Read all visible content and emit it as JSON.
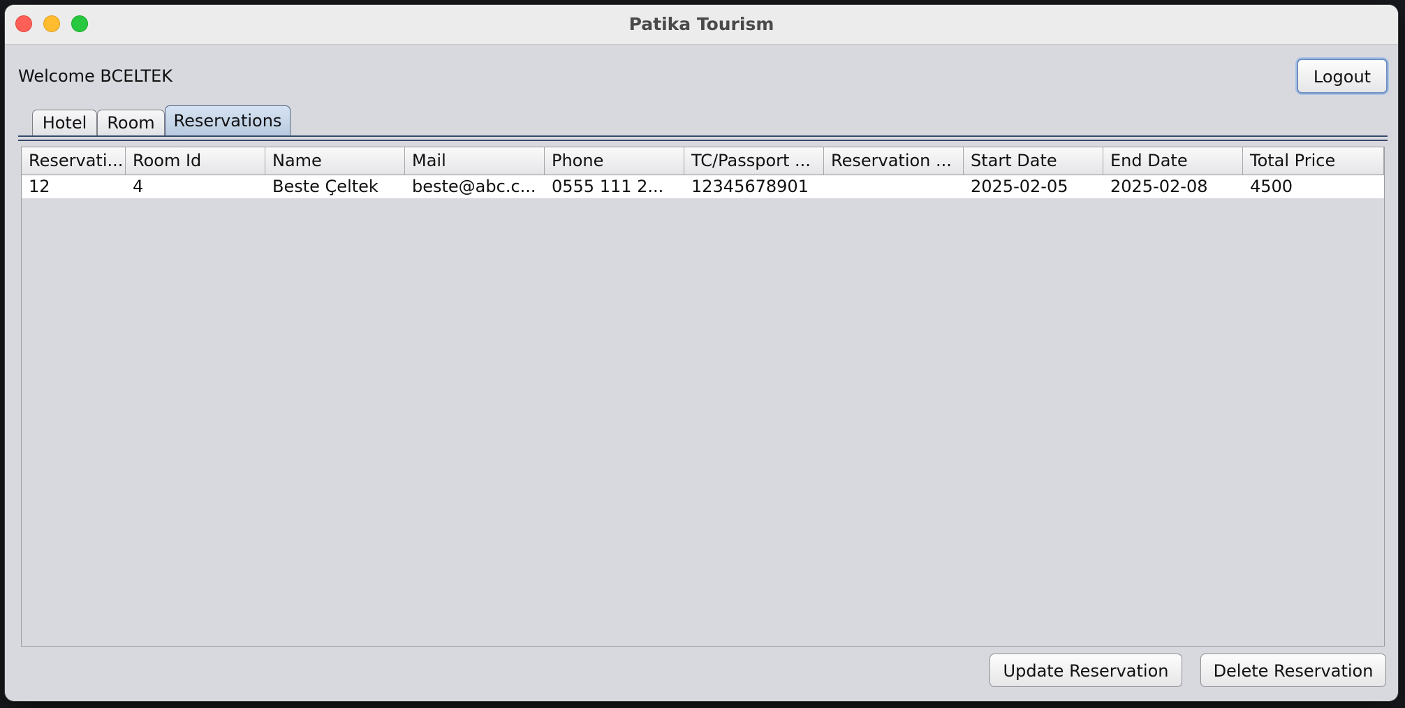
{
  "window": {
    "title": "Patika Tourism"
  },
  "header": {
    "welcome": "Welcome BCELTEK",
    "logout_label": "Logout"
  },
  "tabs": [
    {
      "label": "Hotel"
    },
    {
      "label": "Room"
    },
    {
      "label": "Reservations",
      "selected": true
    }
  ],
  "table": {
    "columns": [
      "Reservati...",
      "Room Id",
      "Name",
      "Mail",
      "Phone",
      "TC/Passport ...",
      "Reservation ...",
      "Start Date",
      "End Date",
      "Total Price"
    ],
    "rows": [
      [
        "12",
        "4",
        "Beste Çeltek",
        "beste@abc.c...",
        "0555 111 2...",
        "12345678901",
        "",
        "2025-02-05",
        "2025-02-08",
        "4500"
      ]
    ]
  },
  "actions": {
    "update_label": "Update Reservation",
    "delete_label": "Delete Reservation"
  },
  "colors": {
    "window_bg": "#d8d9de",
    "selected_tab": "#b9cbe0",
    "tab_underline": "#35496b"
  }
}
